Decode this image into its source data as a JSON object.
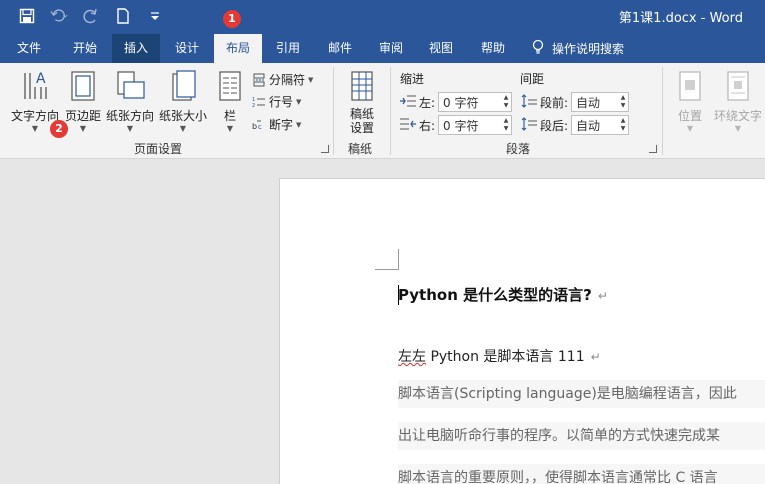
{
  "title_bar": {
    "doc_title": "第1课1.docx  -  Word",
    "qat_icons": [
      "save-icon",
      "undo-icon",
      "redo-icon",
      "new-document-icon",
      "customize-qat-icon"
    ]
  },
  "tabs": {
    "file": "文件",
    "home": "开始",
    "insert": "插入",
    "design": "设计",
    "layout": "布局",
    "references": "引用",
    "mailings": "邮件",
    "review": "审阅",
    "view": "视图",
    "help": "帮助",
    "tell_me": "操作说明搜索"
  },
  "ribbon": {
    "text_direction": "文字方向",
    "margins": "页边距",
    "orientation": "纸张方向",
    "size": "纸张大小",
    "columns": "栏",
    "breaks": "分隔符",
    "line_numbers": "行号",
    "hyphenation": "断字",
    "page_setup_group": "页面设置",
    "draft_settings": "稿纸\n设置",
    "draft_group": "稿纸",
    "indent_label": "缩进",
    "spacing_label": "间距",
    "indent_left_label": "左:",
    "indent_right_label": "右:",
    "indent_left_value": "0 字符",
    "indent_right_value": "0 字符",
    "spacing_before_label": "段前:",
    "spacing_after_label": "段后:",
    "spacing_before_value": "自动",
    "spacing_after_value": "自动",
    "paragraph_group": "段落",
    "position": "位置",
    "wrap_text": "环绕文字"
  },
  "badges": {
    "one": "1",
    "two": "2"
  },
  "document": {
    "heading": "Python  是什么类型的语言?",
    "para_mark": "↵",
    "line1_a": "左左",
    "line1_b": "  Python 是脚本语言 111",
    "line2": "脚本语言(Scripting language)是电脑编程语言，因此",
    "line3": "出让电脑听命行事的程序。以简单的方式快速完成某",
    "line4": "脚本语言的重要原则，，使得脚本语言通常比 C 语言"
  },
  "colors": {
    "accent": "#2b579a",
    "badge": "#e53935"
  }
}
